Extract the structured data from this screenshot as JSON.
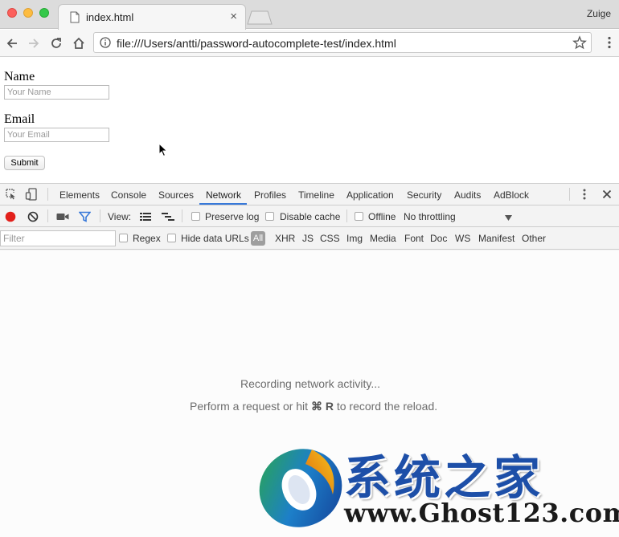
{
  "browser": {
    "tab_title": "index.html",
    "tab_close": "×",
    "profile_name": "Zuige",
    "url": "file:///Users/antti/password-autocomplete-test/index.html"
  },
  "page": {
    "name_label": "Name",
    "name_placeholder": "Your Name",
    "email_label": "Email",
    "email_placeholder": "Your Email",
    "submit_label": "Submit"
  },
  "devtools": {
    "tabs": [
      "Elements",
      "Console",
      "Sources",
      "Network",
      "Profiles",
      "Timeline",
      "Application",
      "Security",
      "Audits",
      "AdBlock"
    ],
    "active_tab": "Network",
    "view_label": "View:",
    "preserve_log": "Preserve log",
    "disable_cache": "Disable cache",
    "offline": "Offline",
    "throttling": "No throttling",
    "filter_placeholder": "Filter",
    "regex": "Regex",
    "hide_data_urls": "Hide data URLs",
    "filter_types": [
      "All",
      "XHR",
      "JS",
      "CSS",
      "Img",
      "Media",
      "Font",
      "Doc",
      "WS",
      "Manifest",
      "Other"
    ],
    "recording_text": "Recording network activity...",
    "hint_prefix": "Perform a request or hit ",
    "hint_key": "⌘ R",
    "hint_suffix": " to record the reload."
  },
  "watermark": {
    "chinese": "系统之家",
    "url": "www.Ghost123.com"
  },
  "colors": {
    "accent": "#3879d9",
    "record": "#e2201b",
    "watermark_blue": "#1d4fa8"
  }
}
